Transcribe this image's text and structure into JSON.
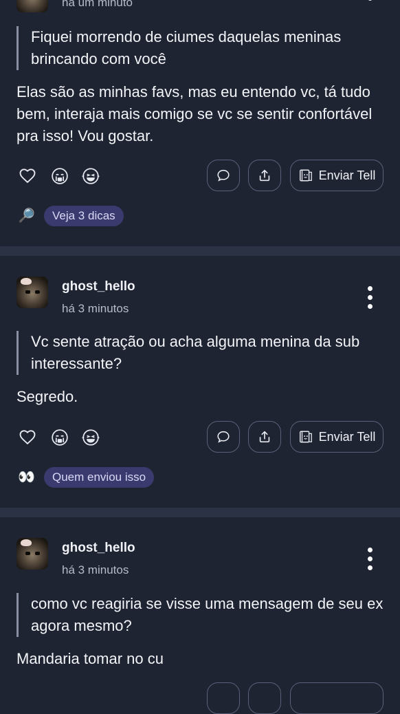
{
  "post_top": {
    "time": "há um minuto",
    "question": "Fiquei morrendo de ciumes daquelas meninas brincando com você",
    "answer": "Elas são as minhas favs, mas eu entendo vc, tá tudo bem, interaja mais comigo se vc se sentir confortável pra isso! Vou gostar.",
    "send_tell_label": "Enviar Tell",
    "hint_emoji": "🔎",
    "hint_label": "Veja 3 dicas"
  },
  "post_mid": {
    "username": "ghost_hello",
    "time": "há 3 minutos",
    "question": "Vc sente atração ou acha alguma menina da sub interessante?",
    "answer": "Segredo.",
    "send_tell_label": "Enviar Tell",
    "hint_emoji": "👀",
    "hint_label": "Quem enviou isso"
  },
  "post_bottom": {
    "username": "ghost_hello",
    "time": "há 3 minutos",
    "question": "como vc reagiria se visse uma mensagem de seu ex agora mesmo?",
    "answer": "Mandaria tomar no cu"
  }
}
